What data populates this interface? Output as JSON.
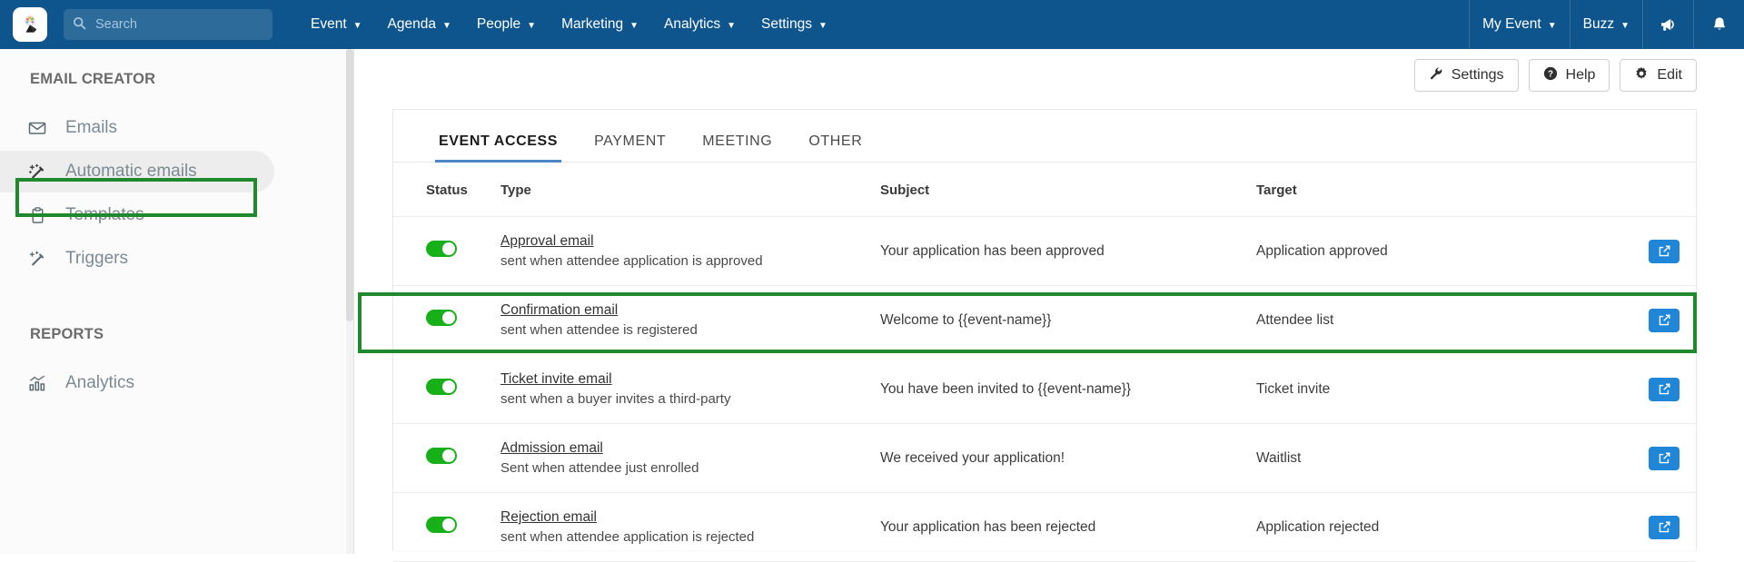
{
  "topnav": {
    "logo_icon": "app-logo-icon",
    "search": {
      "placeholder": "Search",
      "value": "",
      "icon": "search-icon"
    },
    "menu": [
      {
        "label": "Event",
        "caret": "⌄"
      },
      {
        "label": "Agenda",
        "caret": "⌄"
      },
      {
        "label": "People",
        "caret": "⌄"
      },
      {
        "label": "Marketing",
        "caret": "⌄"
      },
      {
        "label": "Analytics",
        "caret": "⌄"
      },
      {
        "label": "Settings",
        "caret": "⌄"
      }
    ],
    "right_menu": [
      {
        "label": "My Event",
        "caret": "⌄"
      },
      {
        "label": "Buzz",
        "caret": "⌄"
      }
    ],
    "icons": [
      {
        "name": "megaphone-icon"
      },
      {
        "name": "bell-icon"
      }
    ],
    "background_color": "#0d558c"
  },
  "sidebar": {
    "section1_title": "EMAIL CREATOR",
    "items": [
      {
        "label": "Emails",
        "icon": "envelope-icon"
      },
      {
        "label": "Automatic emails",
        "icon": "magic-wand-icon"
      },
      {
        "label": "Templates",
        "icon": "clipboard-icon"
      },
      {
        "label": "Triggers",
        "icon": "wand-sparkle-icon"
      }
    ],
    "section2_title": "REPORTS",
    "items2": [
      {
        "label": "Analytics",
        "icon": "bar-chart-icon"
      }
    ],
    "active_index": 1,
    "highlight_color": "#1e8a2d"
  },
  "toolbar": {
    "buttons": [
      {
        "label": "Settings",
        "icon": "wrench-icon"
      },
      {
        "label": "Help",
        "icon": "question-circle-icon"
      },
      {
        "label": "Edit",
        "icon": "gear-icon"
      }
    ]
  },
  "tabs": [
    {
      "label": "EVENT ACCESS",
      "active": true
    },
    {
      "label": "PAYMENT",
      "active": false
    },
    {
      "label": "MEETING",
      "active": false
    },
    {
      "label": "OTHER",
      "active": false
    }
  ],
  "table": {
    "headers": [
      "Status",
      "Type",
      "Subject",
      "Target"
    ],
    "rows": [
      {
        "status": "on",
        "type_title": "Approval email",
        "type_sub": "sent when attendee application is approved",
        "subject": "Your application has been approved",
        "target": "Application approved",
        "action_icon": "external-link-icon",
        "highlighted": false
      },
      {
        "status": "on",
        "type_title": "Confirmation email",
        "type_sub": "sent when attendee is registered",
        "subject": "Welcome to {{event-name}}",
        "target": "Attendee list",
        "action_icon": "external-link-icon",
        "highlighted": true
      },
      {
        "status": "on",
        "type_title": "Ticket invite email",
        "type_sub": "sent when a buyer invites a third-party",
        "subject": "You have been invited to {{event-name}}",
        "target": "Ticket invite",
        "action_icon": "external-link-icon",
        "highlighted": false
      },
      {
        "status": "on",
        "type_title": "Admission email",
        "type_sub": "Sent when attendee just enrolled",
        "subject": "We received your application!",
        "target": "Waitlist",
        "action_icon": "external-link-icon",
        "highlighted": false
      },
      {
        "status": "on",
        "type_title": "Rejection email",
        "type_sub": "sent when attendee application is rejected",
        "subject": "Your application has been rejected",
        "target": "Application rejected",
        "action_icon": "external-link-icon",
        "highlighted": false
      }
    ]
  },
  "colors": {
    "nav_blue": "#0d558c",
    "toggle_green": "#18b018",
    "action_blue": "#1f86d8",
    "tab_underline": "#4a86c5",
    "annotation_green": "#1e8a2d"
  }
}
